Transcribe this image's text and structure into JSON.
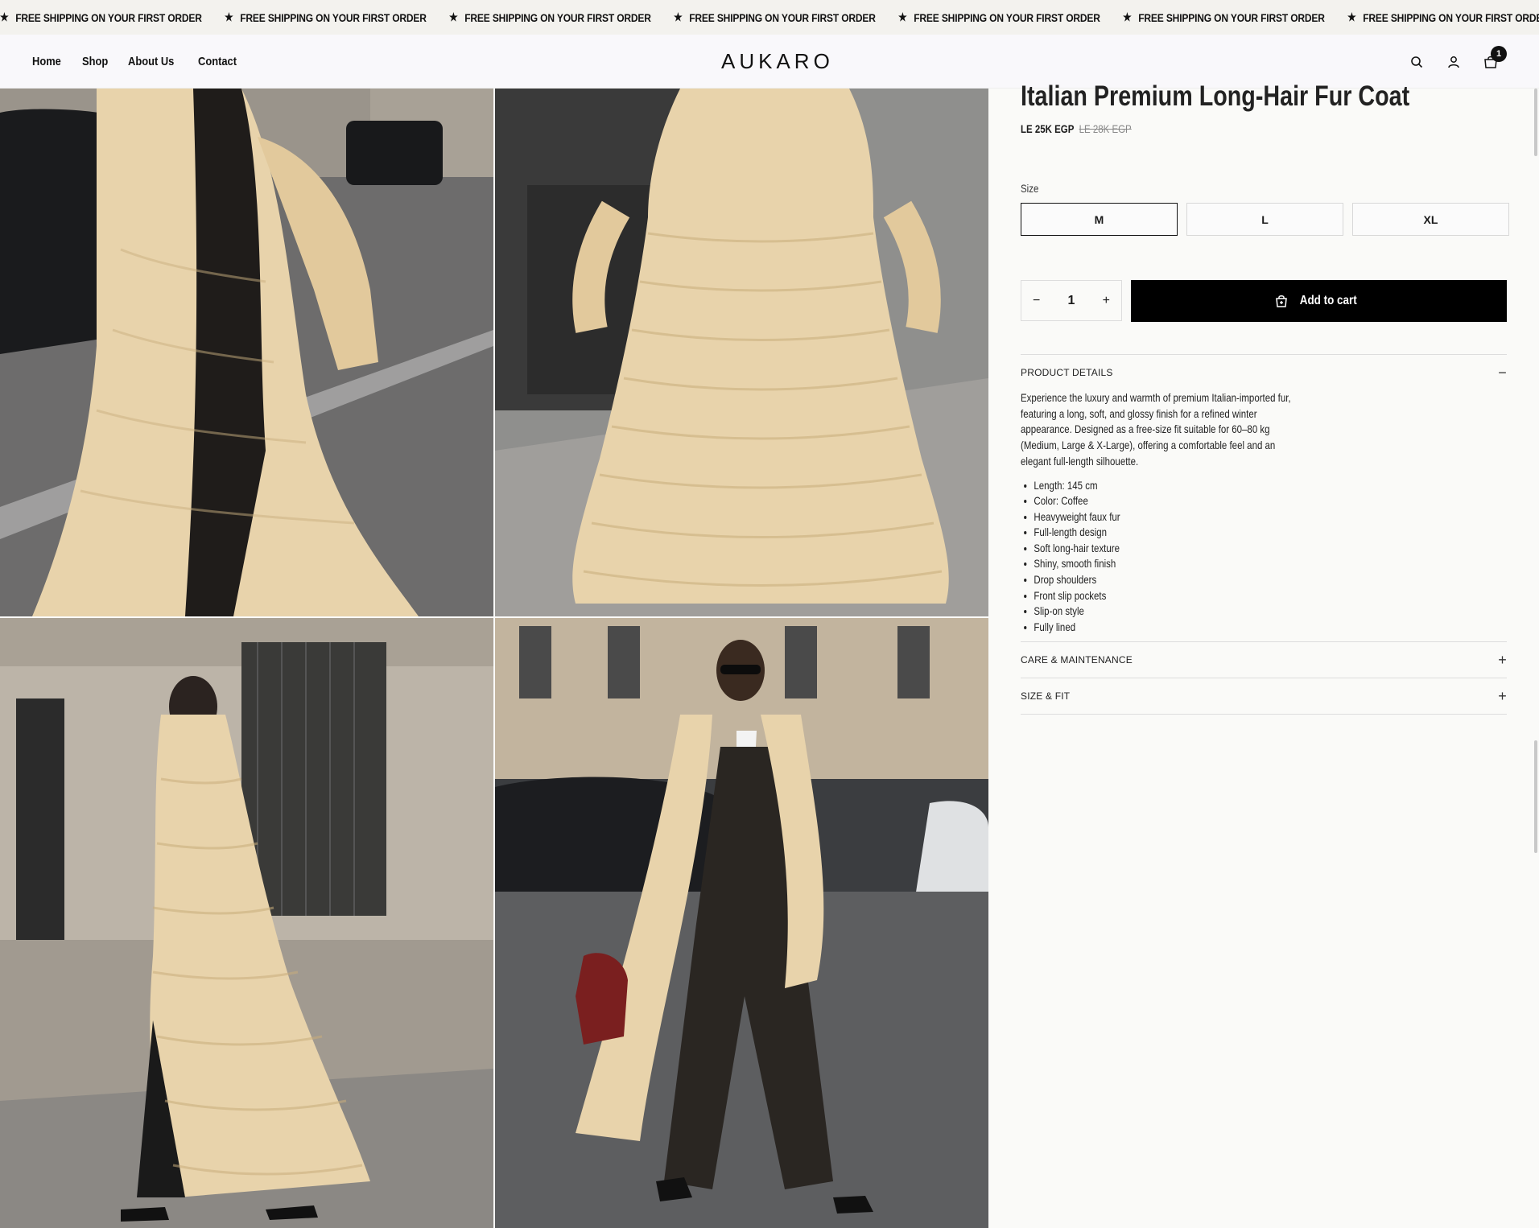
{
  "announcement": {
    "items": [
      "FREE SHIPPING ON YOUR FIRST ORDER",
      "FREE SHIPPING ON YOUR FIRST ORDER",
      "FREE SHIPPING ON YOUR FIRST ORDER",
      "FREE SHIPPING ON YOUR FIRST ORDER",
      "FREE SHIPPING ON YOUR FIRST ORDER",
      "FREE SHIPPING ON YOUR FIRST ORDER",
      "FREE SHIPPING ON YOUR FIRST ORDER"
    ]
  },
  "header": {
    "nav": [
      "Home",
      "Shop",
      "About Us",
      "Contact"
    ],
    "logo": "AUKARO",
    "cart_count": "1"
  },
  "product": {
    "title": "Italian Premium Long-Hair Fur Coat",
    "price": "LE 25K EGP",
    "compare_price": "LE 28K EGP",
    "size_label": "Size",
    "sizes": [
      "M",
      "L",
      "XL"
    ],
    "selected_size": "M",
    "quantity": "1",
    "add_to_cart": "Add to cart"
  },
  "accordion": {
    "details_title": "PRODUCT DETAILS",
    "details_text": "Experience the luxury and warmth of premium Italian-imported fur, featuring a long, soft, and glossy finish for a refined winter appearance. Designed as a free-size fit suitable for 60–80 kg (Medium, Large & X-Large), offering a comfortable feel and an elegant full-length silhouette.",
    "bullets": [
      "Length: 145 cm",
      "Color: Coffee",
      "Heavyweight faux fur",
      "Full-length design",
      "Soft long-hair texture",
      "Shiny, smooth finish",
      "Drop shoulders",
      "Front slip pockets",
      "Slip-on style",
      "Fully lined"
    ],
    "care_title": "CARE & MAINTENANCE",
    "fit_title": "SIZE & FIT"
  },
  "colors": {
    "coat": "#e8d3ab",
    "street": "#6f6f70",
    "stone": "#b8b0a4"
  }
}
